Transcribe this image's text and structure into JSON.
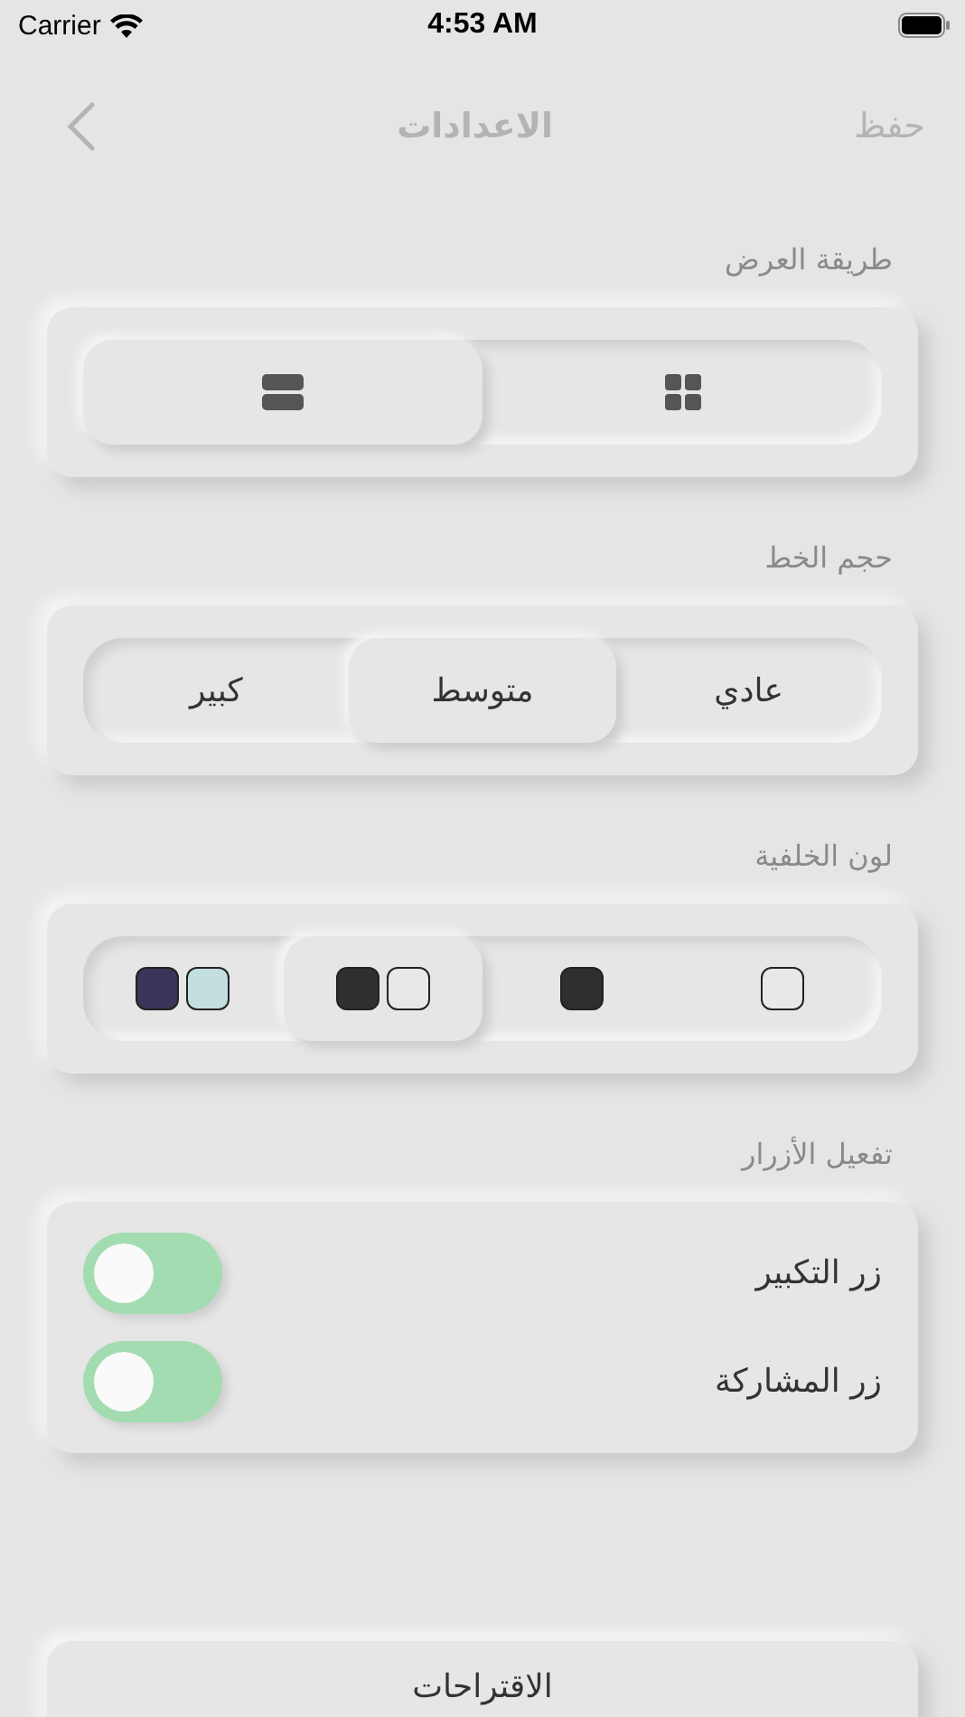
{
  "status_bar": {
    "carrier": "Carrier",
    "time": "4:53 AM"
  },
  "nav": {
    "title": "الاعدادات",
    "action": "حفظ"
  },
  "view_mode": {
    "label": "طريقة العرض",
    "options": [
      {
        "kind": "grid",
        "selected": false
      },
      {
        "kind": "rows",
        "selected": true
      }
    ]
  },
  "font_size": {
    "label": "حجم الخط",
    "options": [
      {
        "label": "عادي",
        "selected": false
      },
      {
        "label": "متوسط",
        "selected": true
      },
      {
        "label": "كبير",
        "selected": false
      }
    ]
  },
  "background_color": {
    "label": "لون الخلفية",
    "options": [
      {
        "selected": false,
        "swatches": [
          {
            "color": "#e8e8e8"
          }
        ]
      },
      {
        "selected": false,
        "swatches": [
          {
            "color": "#2f2f2f"
          }
        ]
      },
      {
        "selected": true,
        "swatches": [
          {
            "color": "#e8e8e8"
          },
          {
            "color": "#2f2f2f"
          }
        ]
      },
      {
        "selected": false,
        "swatches": [
          {
            "color": "#c3dede"
          },
          {
            "color": "#3a3558"
          }
        ]
      }
    ]
  },
  "buttons": {
    "label": "تفعيل الأزرار",
    "items": [
      {
        "label": "زر التكبير",
        "on": true
      },
      {
        "label": "زر المشاركة",
        "on": true
      }
    ]
  },
  "suggestions": {
    "label": "الاقتراحات"
  }
}
